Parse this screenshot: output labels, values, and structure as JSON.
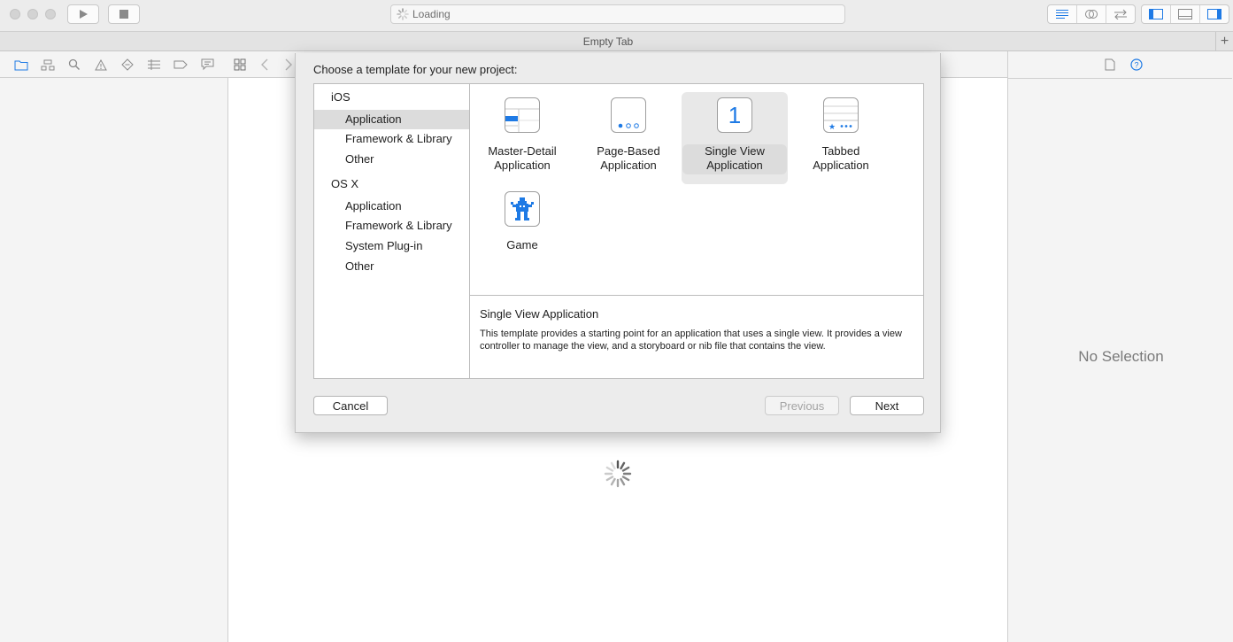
{
  "toolbar": {
    "activity_text": "Loading"
  },
  "tabbar": {
    "title": "Empty Tab",
    "add_label": "+"
  },
  "inspector": {
    "empty_text": "No Selection"
  },
  "sheet": {
    "title": "Choose a template for your new project:",
    "categories": [
      {
        "group": "iOS",
        "items": [
          "Application",
          "Framework & Library",
          "Other"
        ]
      },
      {
        "group": "OS X",
        "items": [
          "Application",
          "Framework & Library",
          "System Plug-in",
          "Other"
        ]
      }
    ],
    "selected_category": "iOS / Application",
    "templates": [
      {
        "label": "Master-Detail Application",
        "icon": "master-detail-icon"
      },
      {
        "label": "Page-Based Application",
        "icon": "page-based-icon"
      },
      {
        "label": "Single View Application",
        "icon": "single-view-icon",
        "icon_text": "1",
        "selected": true
      },
      {
        "label": "Tabbed Application",
        "icon": "tabbed-icon"
      },
      {
        "label": "Game",
        "icon": "game-icon"
      }
    ],
    "description": {
      "title": "Single View Application",
      "text": "This template provides a starting point for an application that uses a single view. It provides a view controller to manage the view, and a storyboard or nib file that contains the view."
    },
    "buttons": {
      "cancel": "Cancel",
      "previous": "Previous",
      "next": "Next"
    }
  },
  "colors": {
    "accent": "#1e7ae5",
    "selection_gray": "#dcdcdc"
  }
}
